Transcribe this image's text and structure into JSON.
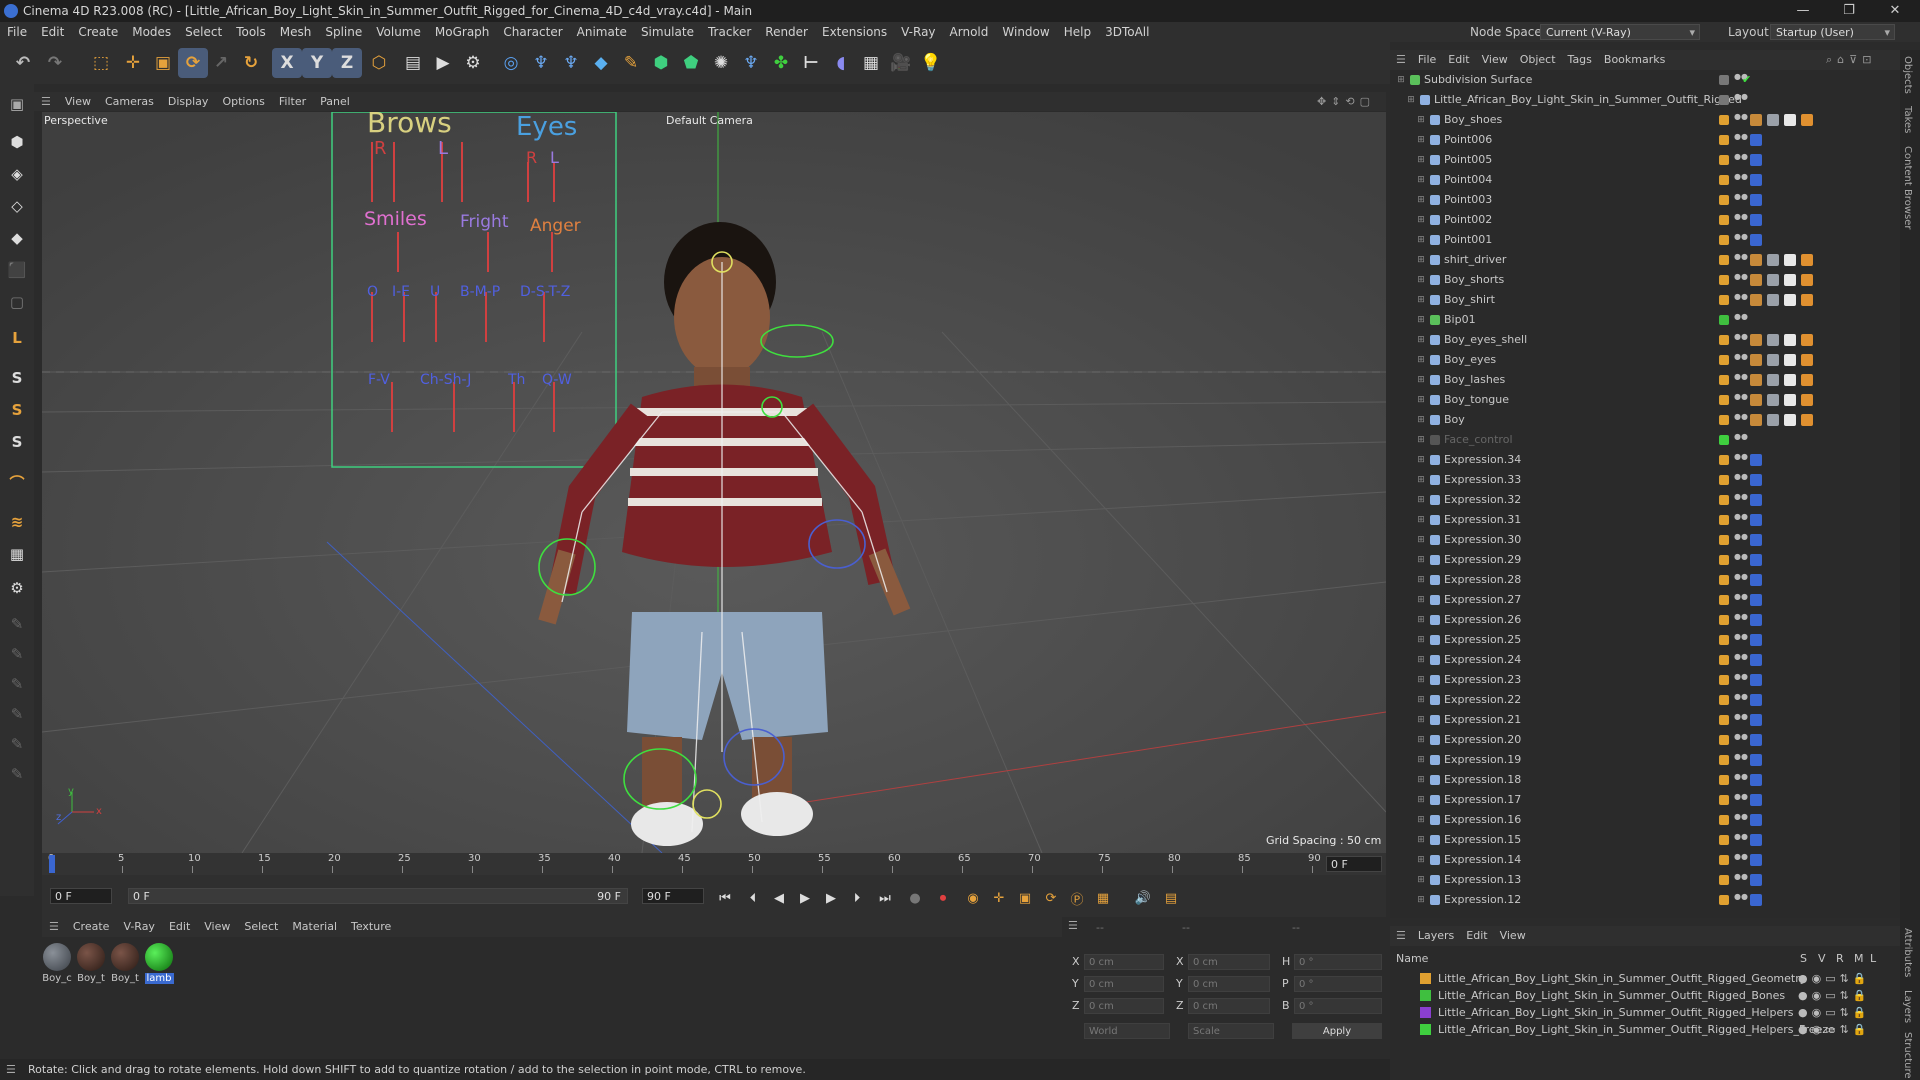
{
  "window": {
    "title": "Cinema 4D R23.008 (RC) - [Little_African_Boy_Light_Skin_in_Summer_Outfit_Rigged_for_Cinema_4D_c4d_vray.c4d] - Main"
  },
  "menubar": [
    "File",
    "Edit",
    "Create",
    "Modes",
    "Select",
    "Tools",
    "Mesh",
    "Spline",
    "Volume",
    "MoGraph",
    "Character",
    "Animate",
    "Simulate",
    "Tracker",
    "Render",
    "Extensions",
    "V-Ray",
    "Arnold",
    "Window",
    "Help",
    "3DToAll"
  ],
  "nodespace": {
    "label": "Node Space:",
    "value": "Current (V-Ray)",
    "layout_label": "Layout:",
    "layout_value": "Startup (User)"
  },
  "toolbar": {
    "axis_x": "X",
    "axis_y": "Y",
    "axis_z": "Z"
  },
  "lefttools": {
    "s1": "S",
    "s2": "S",
    "s3": "S",
    "l": "L"
  },
  "viewport": {
    "menu": [
      "View",
      "Cameras",
      "Display",
      "Options",
      "Filter",
      "Panel"
    ],
    "perspective": "Perspective",
    "camera": "Default Camera",
    "grid_spacing": "Grid Spacing : 50 cm",
    "face_labels": {
      "brows": "Brows",
      "eyes": "Eyes",
      "r1": "R",
      "l1": "L",
      "r2": "R",
      "l2": "L",
      "smiles": "Smiles",
      "fright": "Fright",
      "anger": "Anger",
      "o": "O",
      "ie": "I-E",
      "u": "U",
      "bmp": "B-M-P",
      "dstz": "D-S-T-Z",
      "fv": "F-V",
      "chshj": "Ch-Sh-J",
      "th": "Th",
      "qw": "Q-W"
    },
    "axis_y": "y",
    "axis_z": "z",
    "axis_x": "x"
  },
  "timeline": {
    "ticks": [
      "0",
      "5",
      "10",
      "15",
      "20",
      "25",
      "30",
      "35",
      "40",
      "45",
      "50",
      "55",
      "60",
      "65",
      "70",
      "75",
      "80",
      "85",
      "90"
    ],
    "current": "0 F"
  },
  "timebar": {
    "start": "0 F",
    "slider_start": "0 F",
    "slider_end": "90 F",
    "end": "90 F"
  },
  "materials": {
    "menu": [
      "Create",
      "V-Ray",
      "Edit",
      "View",
      "Select",
      "Material",
      "Texture"
    ],
    "items": [
      {
        "label": "Boy_c",
        "color": "#5a5f66"
      },
      {
        "label": "Boy_t",
        "color": "#4a3028"
      },
      {
        "label": "Boy_t",
        "color": "#4a3028"
      },
      {
        "label": "lamb",
        "color": "#1fa51f"
      }
    ]
  },
  "coords": {
    "header1": "--",
    "header2": "--",
    "header3": "--",
    "rows": [
      {
        "a": "X",
        "av": "0 cm",
        "b": "X",
        "bv": "0 cm",
        "c": "H",
        "cv": "0 °"
      },
      {
        "a": "Y",
        "av": "0 cm",
        "b": "Y",
        "bv": "0 cm",
        "c": "P",
        "cv": "0 °"
      },
      {
        "a": "Z",
        "av": "0 cm",
        "b": "Z",
        "bv": "0 cm",
        "c": "B",
        "cv": "0 °"
      }
    ],
    "world": "World",
    "scale": "Scale",
    "apply": "Apply"
  },
  "status": "Rotate: Click and drag to rotate elements. Hold down SHIFT to add to quantize rotation / add to the selection in point mode, CTRL to remove.",
  "objects": {
    "menu": [
      "File",
      "Edit",
      "View",
      "Object",
      "Tags",
      "Bookmarks"
    ],
    "rows": [
      {
        "name": "Subdivision Surface",
        "indent": 0,
        "icon": "#5bc05b"
      },
      {
        "name": "Little_African_Boy_Light_Skin_in_Summer_Outfit_Rigged",
        "indent": 1,
        "icon": "#8fb0e0"
      },
      {
        "name": "Boy_shoes",
        "indent": 2,
        "icon": "#8fb0e0"
      },
      {
        "name": "Point006",
        "indent": 2,
        "icon": "#8fb0e0"
      },
      {
        "name": "Point005",
        "indent": 2,
        "icon": "#8fb0e0"
      },
      {
        "name": "Point004",
        "indent": 2,
        "icon": "#8fb0e0"
      },
      {
        "name": "Point003",
        "indent": 2,
        "icon": "#8fb0e0"
      },
      {
        "name": "Point002",
        "indent": 2,
        "icon": "#8fb0e0"
      },
      {
        "name": "Point001",
        "indent": 2,
        "icon": "#8fb0e0"
      },
      {
        "name": "shirt_driver",
        "indent": 2,
        "icon": "#8fb0e0"
      },
      {
        "name": "Boy_shorts",
        "indent": 2,
        "icon": "#8fb0e0"
      },
      {
        "name": "Boy_shirt",
        "indent": 2,
        "icon": "#8fb0e0"
      },
      {
        "name": "Bip01",
        "indent": 2,
        "icon": "#5bc05b"
      },
      {
        "name": "Boy_eyes_shell",
        "indent": 2,
        "icon": "#8fb0e0"
      },
      {
        "name": "Boy_eyes",
        "indent": 2,
        "icon": "#8fb0e0"
      },
      {
        "name": "Boy_lashes",
        "indent": 2,
        "icon": "#8fb0e0"
      },
      {
        "name": "Boy_tongue",
        "indent": 2,
        "icon": "#8fb0e0"
      },
      {
        "name": "Boy",
        "indent": 2,
        "icon": "#8fb0e0"
      },
      {
        "name": "Face_control",
        "indent": 2,
        "icon": "#555"
      },
      {
        "name": "Expression.34",
        "indent": 2,
        "icon": "#8fb0e0"
      },
      {
        "name": "Expression.33",
        "indent": 2,
        "icon": "#8fb0e0"
      },
      {
        "name": "Expression.32",
        "indent": 2,
        "icon": "#8fb0e0"
      },
      {
        "name": "Expression.31",
        "indent": 2,
        "icon": "#8fb0e0"
      },
      {
        "name": "Expression.30",
        "indent": 2,
        "icon": "#8fb0e0"
      },
      {
        "name": "Expression.29",
        "indent": 2,
        "icon": "#8fb0e0"
      },
      {
        "name": "Expression.28",
        "indent": 2,
        "icon": "#8fb0e0"
      },
      {
        "name": "Expression.27",
        "indent": 2,
        "icon": "#8fb0e0"
      },
      {
        "name": "Expression.26",
        "indent": 2,
        "icon": "#8fb0e0"
      },
      {
        "name": "Expression.25",
        "indent": 2,
        "icon": "#8fb0e0"
      },
      {
        "name": "Expression.24",
        "indent": 2,
        "icon": "#8fb0e0"
      },
      {
        "name": "Expression.23",
        "indent": 2,
        "icon": "#8fb0e0"
      },
      {
        "name": "Expression.22",
        "indent": 2,
        "icon": "#8fb0e0"
      },
      {
        "name": "Expression.21",
        "indent": 2,
        "icon": "#8fb0e0"
      },
      {
        "name": "Expression.20",
        "indent": 2,
        "icon": "#8fb0e0"
      },
      {
        "name": "Expression.19",
        "indent": 2,
        "icon": "#8fb0e0"
      },
      {
        "name": "Expression.18",
        "indent": 2,
        "icon": "#8fb0e0"
      },
      {
        "name": "Expression.17",
        "indent": 2,
        "icon": "#8fb0e0"
      },
      {
        "name": "Expression.16",
        "indent": 2,
        "icon": "#8fb0e0"
      },
      {
        "name": "Expression.15",
        "indent": 2,
        "icon": "#8fb0e0"
      },
      {
        "name": "Expression.14",
        "indent": 2,
        "icon": "#8fb0e0"
      },
      {
        "name": "Expression.13",
        "indent": 2,
        "icon": "#8fb0e0"
      },
      {
        "name": "Expression.12",
        "indent": 2,
        "icon": "#8fb0e0"
      }
    ]
  },
  "layers": {
    "menu": [
      "Layers",
      "Edit",
      "View"
    ],
    "header": {
      "name": "Name",
      "s": "S",
      "v": "V",
      "r": "R",
      "m": "M",
      "l": "L"
    },
    "rows": [
      {
        "name": "Little_African_Boy_Light_Skin_in_Summer_Outfit_Rigged_Geometry",
        "color": "#e0a030"
      },
      {
        "name": "Little_African_Boy_Light_Skin_in_Summer_Outfit_Rigged_Bones",
        "color": "#3fbf3f"
      },
      {
        "name": "Little_African_Boy_Light_Skin_in_Summer_Outfit_Rigged_Helpers",
        "color": "#8a3fcf"
      },
      {
        "name": "Little_African_Boy_Light_Skin_in_Summer_Outfit_Rigged_Helpers_Freeze",
        "color": "#3fcf3f"
      }
    ]
  },
  "right_tabs": [
    "Objects",
    "Takes",
    "Content Browser",
    "Attributes",
    "Layers",
    "Structure"
  ]
}
